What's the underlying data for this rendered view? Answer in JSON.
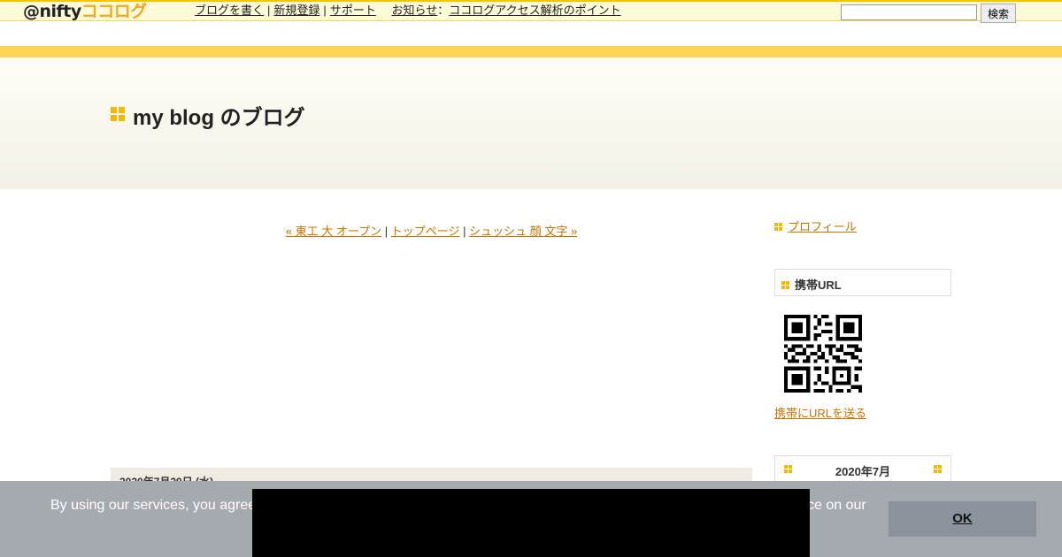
{
  "topbar": {
    "logo_prefix": "@nifty",
    "logo_suffix": "ココログ",
    "nav": [
      "ブログを書く",
      "新規登録",
      "サポート"
    ],
    "notice_label": "お知らせ",
    "notice_sep": "：",
    "notice_link": "ココログアクセス解析のポイント",
    "search_placeholder": "",
    "search_button": "検索"
  },
  "header": {
    "blog_title": "my blog のブログ"
  },
  "main": {
    "entry_nav": {
      "prev": "« 東工 大 オープン",
      "sep": "|",
      "home": "トップページ",
      "next": "シュッシュ 顔 文字 »"
    },
    "date_header": "2020年7月29日 (水)"
  },
  "sidebar": {
    "profile": "プロフィール",
    "mobile_title": "携帯URL",
    "mobile_link": "携帯にURLを送る",
    "calendar_title": "2020年7月"
  },
  "cookie": {
    "text": "By using our services, you agree",
    "text_tail": "ce on our",
    "ok_label": "OK"
  },
  "colors": {
    "accent": "#f5b800",
    "link": "#c77500",
    "stripe": "#fdd456",
    "cookie_bg": "#a5aab1"
  }
}
